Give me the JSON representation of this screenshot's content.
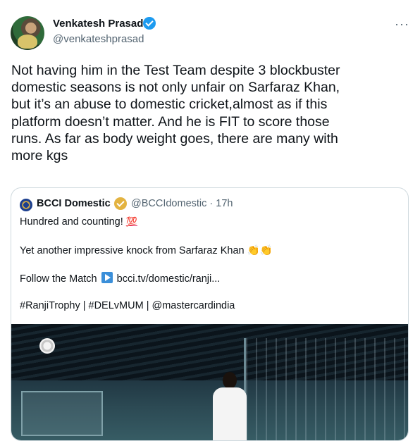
{
  "tweet": {
    "author_name": "Venkatesh Prasad",
    "author_handle": "@venkateshprasad",
    "more_icon": "more-horizontal-icon",
    "text": "Not having him in the Test Team despite 3 blockbuster\ndomestic seasons is not only unfair on Sarfaraz Khan,\nbut it’s an abuse to domestic cricket,almost as if this\nplatform doesn’t matter. And he is FIT to score those\nruns. As far as body weight goes, there are many with\nmore kgs",
    "verified_color": "#1d9bf0"
  },
  "quoted_tweet": {
    "author_name": "BCCI Domestic",
    "author_handle": "@BCCIdomestic",
    "time": "· 17h",
    "line1": "Hundred and counting!",
    "line1_emoji": "💯",
    "line2": "Yet another impressive knock from Sarfaraz Khan",
    "line2_emoji": "👏👏",
    "line3_prefix": "Follow the Match",
    "line3_link": "bcci.tv/domestic/ranji...",
    "line4": "#RanjiTrophy | #DELvMUM | @mastercardindia",
    "badge_color": "#e3b341",
    "media_icon": "cricket-photo"
  }
}
